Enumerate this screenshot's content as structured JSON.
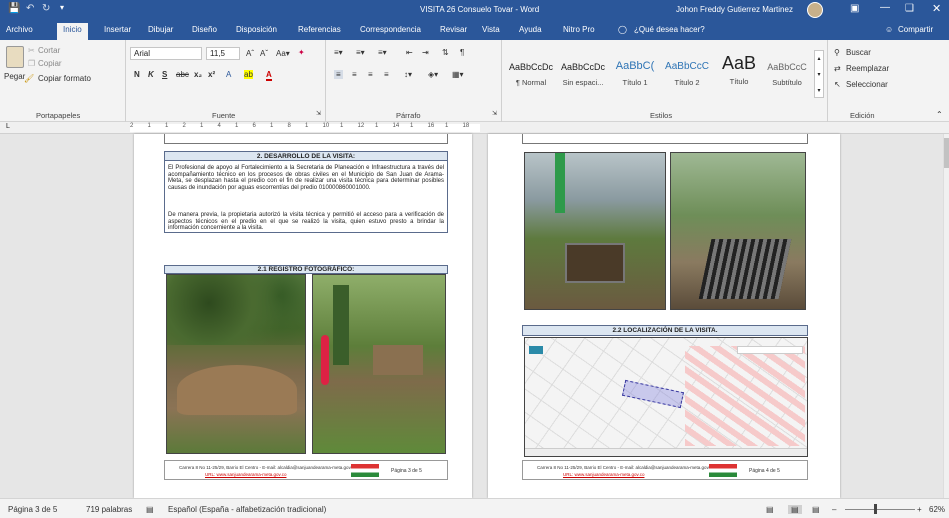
{
  "titlebar": {
    "doc_title": "VISITA 26 Consuelo Tovar  -  Word",
    "user_name": "Johon Freddy Gutierrez Martinez"
  },
  "tabs": [
    "Archivo",
    "Inicio",
    "Insertar",
    "Dibujar",
    "Diseño",
    "Disposición",
    "Referencias",
    "Correspondencia",
    "Revisar",
    "Vista",
    "Ayuda",
    "Nitro Pro"
  ],
  "tell_me": "¿Qué desea hacer?",
  "share": "Compartir",
  "clipboard": {
    "cut": "Cortar",
    "copy": "Copiar",
    "paste": "Pegar",
    "format_painter": "Copiar formato",
    "label": "Portapapeles"
  },
  "font": {
    "family": "Arial",
    "size": "11,5",
    "label": "Fuente"
  },
  "paragraph": {
    "label": "Párrafo"
  },
  "styles": {
    "label": "Estilos",
    "items": [
      {
        "preview": "AaBbCcDc",
        "name": "¶ Normal"
      },
      {
        "preview": "AaBbCcDc",
        "name": "Sin espaci..."
      },
      {
        "preview": "AaBbC(",
        "name": "Título 1"
      },
      {
        "preview": "AaBbCcC",
        "name": "Título 2"
      },
      {
        "preview": "AaB",
        "name": "Título"
      },
      {
        "preview": "AaBbCcC",
        "name": "Subtítulo"
      }
    ]
  },
  "editing": {
    "find": "Buscar",
    "replace": "Reemplazar",
    "select": "Seleccionar",
    "label": "Edición"
  },
  "ruler": {
    "ticks": [
      "2",
      "1",
      "1",
      "2",
      "1",
      "4",
      "1",
      "6",
      "1",
      "8",
      "1",
      "10",
      "1",
      "12",
      "1",
      "14",
      "1",
      "16",
      "1",
      "18"
    ]
  },
  "page_left": {
    "section_title": "2.   DESARROLLO DE LA VISITA:",
    "para1": "El Profesional de apoyo al Fortalecimiento a la Secretaria de Planeación e Infraestructura a través del acompañamiento técnico en los procesos de obras civiles en el Municipio de San Juan de Arama- Meta, se desplazan hasta el predio con el fin de realizar una visita técnica para determinar posibles causas de inundación por aguas escorrentías del predio 010000860001000.",
    "para2": "De manera previa, la propietaria autorizó la visita técnica y permitió el acceso para a verificación de aspectos técnicos en el predio en el que se realizó la visita, quien estuvo presto a brindar la información concerniente a la visita.",
    "photo_title": "2.1     REGISTRO FOTOGRÁFICO:",
    "footer_addr": "Carrera 8 No 11-25/29, Barrio El Centro - E-mail: alcaldia@sanjuandearama-meta.gov.co",
    "footer_url": "URL: www.sanjuandearama-meta.gov.co",
    "footer_page": "Página 3 de 5"
  },
  "page_right": {
    "map_title": "2.2     LOCALIZACIÓN DE LA VISITA.",
    "footer_addr": "Carrera 8 No 11-25/29, Barrio El Centro - E-mail: alcaldia@sanjuandearama-meta.gov.co",
    "footer_url": "URL: www.sanjuandearama-meta.gov.co",
    "footer_page": "Página 4 de 5"
  },
  "status": {
    "page": "Página 3 de 5",
    "words": "719 palabras",
    "language": "Español (España - alfabetización tradicional)",
    "zoom": "62%"
  },
  "colors": {
    "accent": "#2b579a",
    "header_fill": "#dce6f1"
  }
}
